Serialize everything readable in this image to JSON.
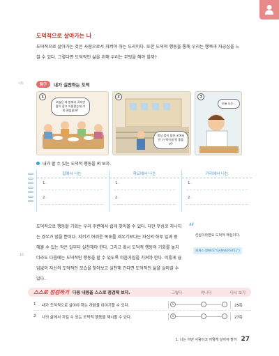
{
  "section": {
    "title": "도덕적으로 살아가는 나",
    "intro": "도덕적으로 살아가는 것은 사람으로서 지켜야 하는 도리이다. 또한 도덕적 행동을 통해 우리는 행복과 자긍심을 느낄 수 있다. 그렇다면 도덕적인 삶을 위해 우리는 무엇을 해야 할까?"
  },
  "line_numbers": {
    "first": "05",
    "second": "10",
    "third": "15"
  },
  "explore": {
    "tag": "탐구",
    "title": "내가 실천하는 도덕"
  },
  "panels": [
    {
      "number": "1",
      "bubble": "오늘은 내 방에서 휴지만 많이 찾고 어질렀는데 이따 괜찮을까?"
    },
    {
      "number": "2",
      "bubble_a": "",
      "bubble_b": "항상 몸이 많은 곳에서 안 가 찍히게 줘 좋을까?"
    },
    {
      "number": "3",
      "bubble": "오늘 나는..."
    }
  ],
  "activity": {
    "instruction": "내가 할 수 있는 도덕적 행동을 써 보자.",
    "columns": [
      {
        "header": "집에서 나는",
        "n1": "1.",
        "n2": "2."
      },
      {
        "header": "학교에서 나는",
        "n1": "1.",
        "n2": "2."
      },
      {
        "header": "거리에서 나는",
        "n1": "1.",
        "n2": "2."
      }
    ]
  },
  "body": {
    "text": "도덕적으로 행동할 기회는 우리 주변에서 쉽게 찾아볼 수 있다. 다만 무심코 지나치는 경우가 많을 뿐이다. 지키기 어려운 목표를 세우기보다는 자신의 하루 일과 중 해볼 수 있는 작은 일부터 실천해야 한다. 그리고 혹시 도덕적 행동의 기회를 놓치더라도 다음에는 도덕적인 행동을 할 수 있도록 마음가짐을 가져야 한다. 이렇게 끊임없이 자신의 도덕적인 모습을 찾아보고 실천해 간다면 도덕적인 삶을 살아갈 수 있다."
  },
  "sidebar": {
    "quote_mark": "“",
    "note": "선심이라면요 도덕적 해심이다.",
    "tag": "회계스 항환(도\"GANVERSTEL\")"
  },
  "self_check": {
    "logo": "스스로 점검하기",
    "title": "다음 내용을 스스로 점검해 보자.",
    "scale": {
      "left": "그렇다",
      "mid": "아니다",
      "right": "다시 보기"
    },
    "rows": [
      {
        "num": "1",
        "text": "내가 도덕적으로 살아야 하는 까닭을 이야기할 수 있다.",
        "ref": "25쪽"
      },
      {
        "num": "2",
        "text": "나의 삶에서 지킬 수 있는 도덕적 행동을 제시할 수 있다.",
        "ref": "27쪽"
      }
    ]
  },
  "footer": {
    "text": "1. 나는 어떤 사람이고 어떻게 살아야 할까",
    "page": "27"
  },
  "colors": {
    "accent": "#e36b6b",
    "blue": "#3a9ed8",
    "check_band": "#fbe4e4"
  }
}
